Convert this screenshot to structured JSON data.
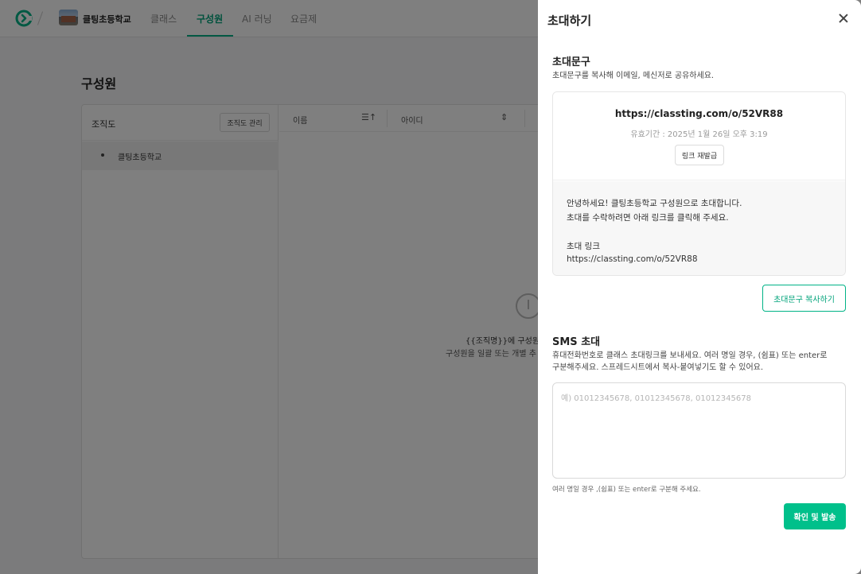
{
  "nav": {
    "school_name": "클팅초등학교",
    "tabs": [
      {
        "label": "클래스"
      },
      {
        "label": "구성원"
      },
      {
        "label": "AI 러닝"
      },
      {
        "label": "요금제"
      }
    ],
    "accent_color": "#00b386"
  },
  "page": {
    "title": "구성원",
    "org": {
      "title": "조직도",
      "manage_label": "조직도 관리",
      "item_label": "클팅초등학교"
    },
    "table_headers": [
      "이름",
      "아이디"
    ],
    "empty": {
      "line1": "{{조직명}}에 구성원 정",
      "line2": "구성원을 일괄 또는 개별 추"
    }
  },
  "drawer": {
    "title": "초대하기",
    "invite": {
      "section_title": "초대문구",
      "section_desc": "초대문구를 복사해 이메일, 메신저로 공유하세요.",
      "url": "https://classting.com/o/52VR88",
      "expire": "유효기간 : 2025년 1월 26일 오후 3:19",
      "reissue_label": "링크 재발급",
      "message_line1": "안녕하세요! 클팅초등학교 구성원으로 초대합니다.",
      "message_line2": "초대를 수락하려면 아래 링크를 클릭해 주세요.",
      "message_line3": "초대 링크",
      "message_line4": "https://classting.com/o/52VR88",
      "copy_label": "초대문구 복사하기"
    },
    "sms": {
      "section_title": "SMS 초대",
      "desc_line1": "휴대전화번호로 클래스 초대링크를 보내세요. 여러 명일 경우, (쉼표) 또는 enter로",
      "desc_line2": "구분해주세요. 스프레드시트에서 복사-붙여넣기도 할 수 있어요.",
      "placeholder": "예) 01012345678, 01012345678, 01012345678",
      "hint": "여러 명일 경우 ,(쉼표) 또는 enter로 구분해 주세요.",
      "send_label": "확인 및 발송"
    }
  }
}
